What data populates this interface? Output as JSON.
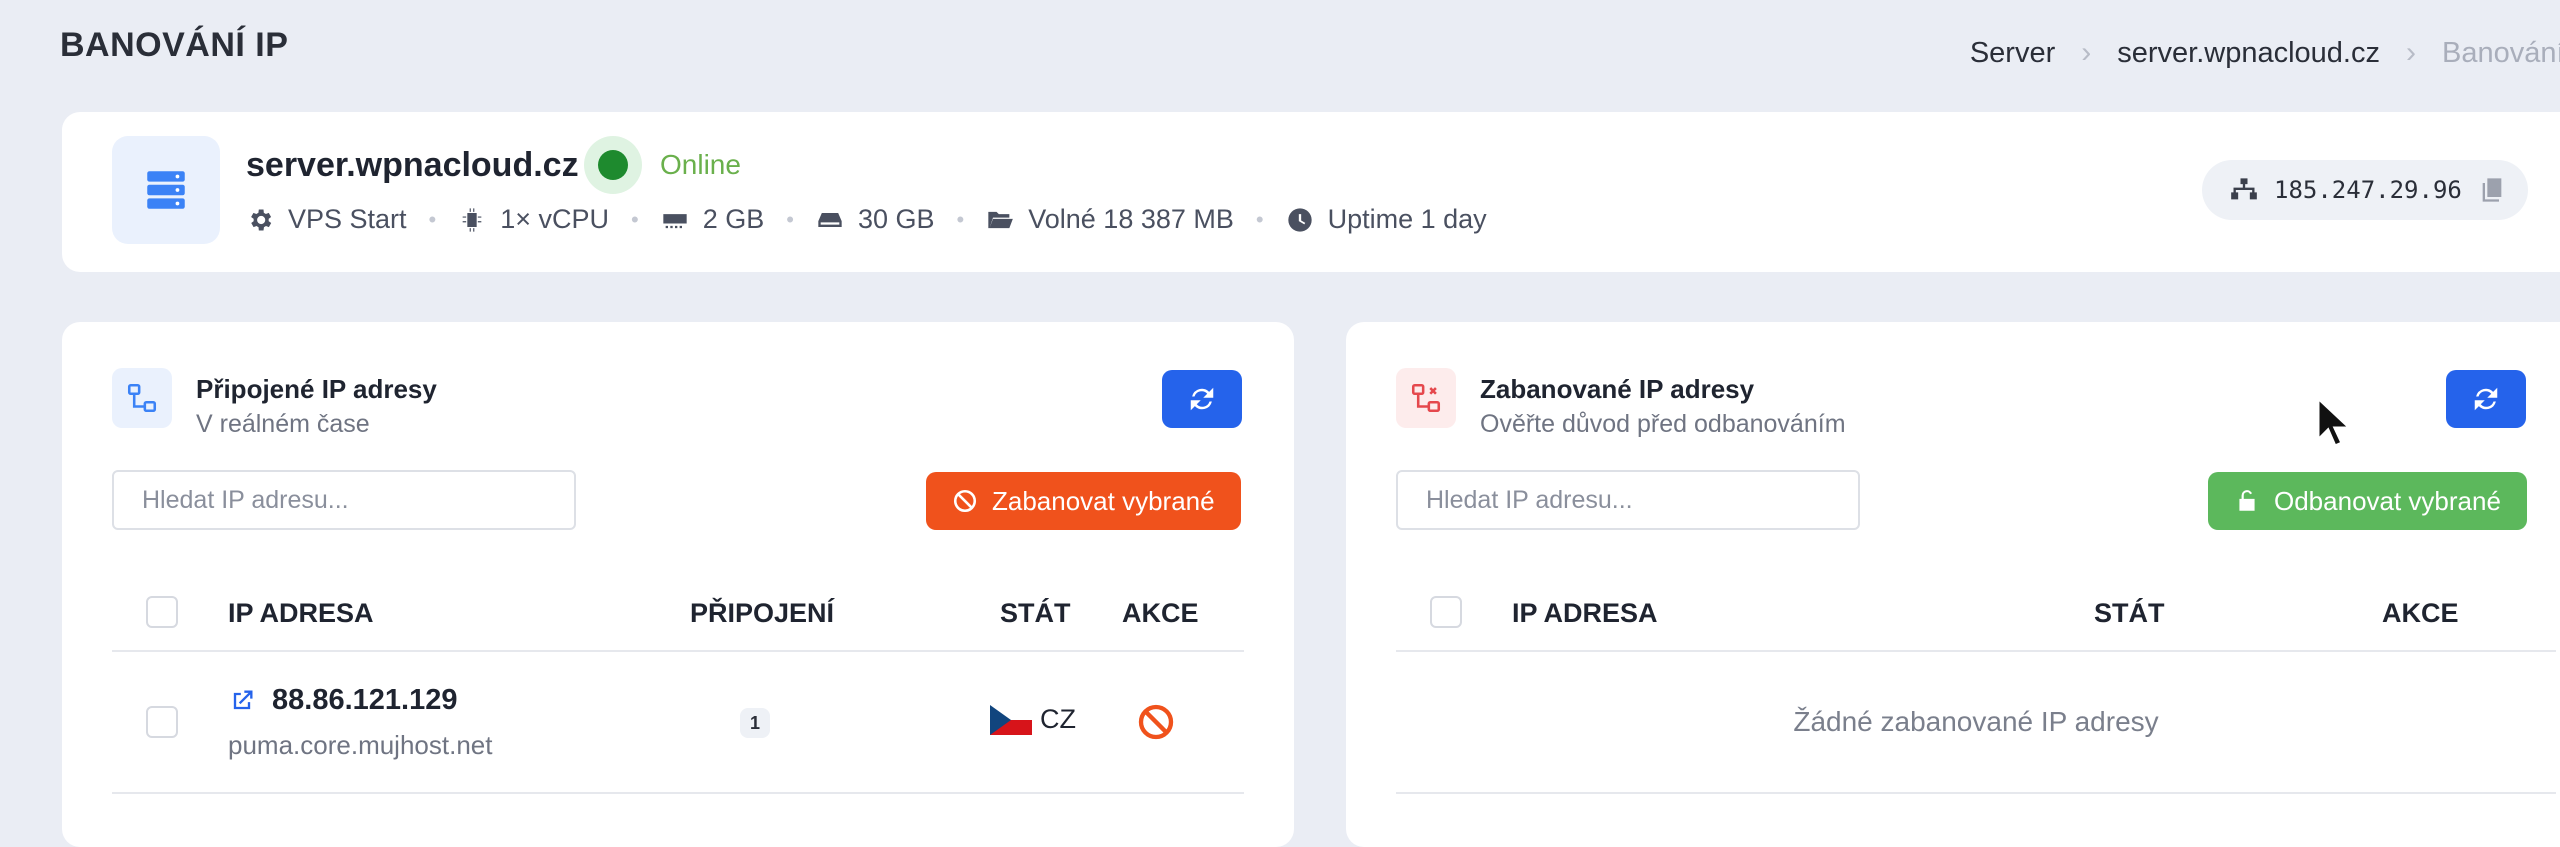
{
  "page": {
    "title": "BANOVÁNÍ IP"
  },
  "breadcrumb": [
    "Server",
    "server.wpnacloud.cz",
    "Banování IP"
  ],
  "server": {
    "name": "server.wpnacloud.cz",
    "status": "Online",
    "status_color": "#1e8a2e",
    "specs": {
      "plan": "VPS Start",
      "cpu": "1× vCPU",
      "ram": "2 GB",
      "disk": "30 GB",
      "free": "Volné 18 387 MB",
      "uptime": "Uptime 1 day"
    },
    "ip": "185.247.29.96"
  },
  "connected": {
    "title": "Připojené IP adresy",
    "subtitle": "V reálném čase",
    "search_placeholder": "Hledat IP adresu...",
    "ban_button": "Zabanovat vybrané",
    "columns": {
      "ip": "IP ADRESA",
      "connections": "PŘIPOJENÍ",
      "country": "STÁT",
      "action": "AKCE"
    },
    "rows": [
      {
        "ip": "88.86.121.129",
        "host": "puma.core.mujhost.net",
        "connections": "1",
        "country": "CZ"
      }
    ]
  },
  "banned": {
    "title": "Zabanované IP adresy",
    "subtitle": "Ověřte důvod před odbanováním",
    "search_placeholder": "Hledat IP adresu...",
    "unban_button": "Odbanovat vybrané",
    "columns": {
      "ip": "IP ADRESA",
      "country": "STÁT",
      "action": "AKCE"
    },
    "empty_text": "Žádné zabanované IP adresy"
  },
  "colors": {
    "accent": "#2563eb",
    "ban": "#f0521c",
    "unban": "#5cb85c",
    "online": "#6ab04c"
  }
}
